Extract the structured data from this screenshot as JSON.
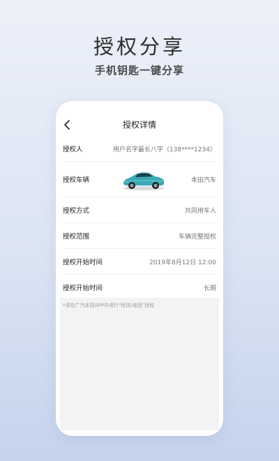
{
  "hero": {
    "title": "授权分享",
    "subtitle": "手机钥匙一键分享"
  },
  "app": {
    "nav": {
      "back_icon": "chevron-left-icon",
      "title": "授权详情"
    },
    "rows": [
      {
        "label": "授权人",
        "value": "用户名字最长八字（138****1234）"
      },
      {
        "label": "授权车辆",
        "value": "本田汽车",
        "image": "car-image"
      },
      {
        "label": "授权方式",
        "value": "共同用车人"
      },
      {
        "label": "授权范围",
        "value": "车辆完整授权"
      },
      {
        "label": "授权开始时间",
        "value": "2019年8月12日 12:00"
      },
      {
        "label": "授权开始时间",
        "value": "长期"
      }
    ],
    "footer_note": "*请在广汽本田APP中进行“修改/收回”授权"
  },
  "colors": {
    "background_top": "#ecf0f9",
    "background_bottom": "#c5d3ec",
    "card": "#ffffff",
    "car_body": "#3aa8b4"
  }
}
